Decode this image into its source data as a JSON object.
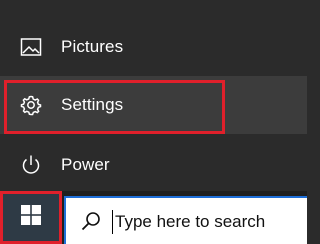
{
  "start_menu": {
    "items": [
      {
        "label": "Pictures",
        "icon": "pictures-icon"
      },
      {
        "label": "Settings",
        "icon": "gear-icon"
      },
      {
        "label": "Power",
        "icon": "power-icon"
      }
    ]
  },
  "taskbar": {
    "start_icon": "windows-logo-icon",
    "search": {
      "placeholder": "Type here to search",
      "icon": "search-icon"
    }
  },
  "colors": {
    "menu_background": "#2b2b2b",
    "hover_background": "#3c3c3c",
    "highlight_border": "#e0202b",
    "search_border": "#1e6fd9"
  }
}
